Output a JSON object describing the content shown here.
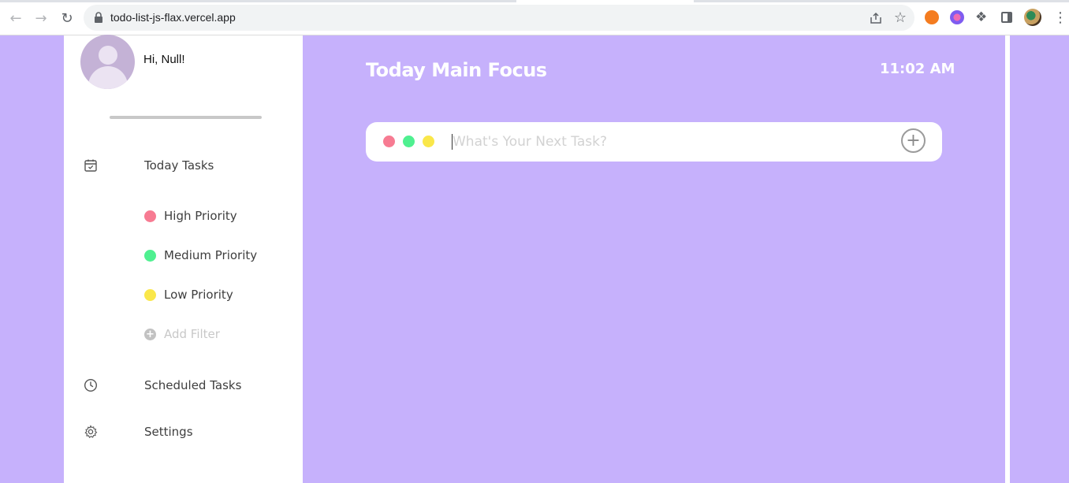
{
  "browser": {
    "url": "todo-list-js-flax.vercel.app",
    "back_icon": "arrow-left",
    "forward_icon": "arrow-right",
    "reload_icon": "reload"
  },
  "sidebar": {
    "greeting": "Hi, Null!",
    "nav": [
      {
        "label": "Today Tasks",
        "icon": "calendar-check-icon"
      },
      {
        "label": "Scheduled Tasks",
        "icon": "clock-icon"
      },
      {
        "label": "Settings",
        "icon": "gear-icon"
      }
    ],
    "filters": [
      {
        "label": "High Priority",
        "color": "#f77b92"
      },
      {
        "label": "Medium Priority",
        "color": "#4ff090"
      },
      {
        "label": "Low Priority",
        "color": "#fae74a"
      }
    ],
    "add_filter": "Add Filter"
  },
  "main": {
    "title": "Today Main Focus",
    "time": "11:02 AM",
    "task_input": {
      "placeholder": "What's Your Next Task?",
      "value": ""
    },
    "priority_dots": [
      "#f77b92",
      "#4ff090",
      "#fae74a"
    ]
  },
  "colors": {
    "accent": "#c6b1fc",
    "sidebar_bg": "#ffffff"
  }
}
